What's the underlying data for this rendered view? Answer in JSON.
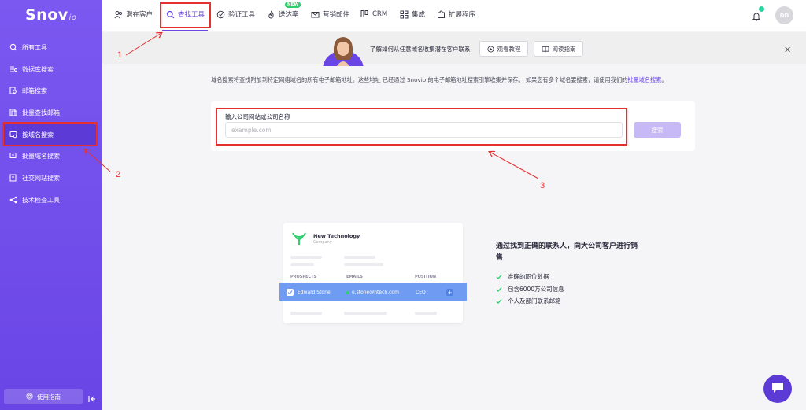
{
  "app": {
    "logo": "Snov",
    "logo_suffix": "io"
  },
  "sidebar": {
    "items": [
      {
        "label": "所有工具",
        "icon": "search-circle-icon"
      },
      {
        "label": "数据库搜索",
        "icon": "list-filter-icon"
      },
      {
        "label": "邮箱搜索",
        "icon": "doc-search-icon"
      },
      {
        "label": "批量查找邮箱",
        "icon": "bulk-doc-icon"
      },
      {
        "label": "按域名搜索",
        "icon": "domain-search-icon",
        "active": true
      },
      {
        "label": "批量域名搜索",
        "icon": "bulk-domain-icon"
      },
      {
        "label": "社交网站搜索",
        "icon": "social-search-icon"
      },
      {
        "label": "技术检查工具",
        "icon": "share-nodes-icon"
      }
    ],
    "guide_label": "使用指南"
  },
  "topnav": {
    "items": [
      {
        "label": "潜在客户",
        "icon": "users-icon"
      },
      {
        "label": "查找工具",
        "icon": "search-icon",
        "active": true
      },
      {
        "label": "验证工具",
        "icon": "check-circle-icon"
      },
      {
        "label": "送达率",
        "icon": "flame-icon",
        "badge": "NEW"
      },
      {
        "label": "营销邮件",
        "icon": "mail-icon"
      },
      {
        "label": "CRM",
        "icon": "crm-icon"
      },
      {
        "label": "集成",
        "icon": "grid-icon"
      },
      {
        "label": "扩展程序",
        "icon": "puzzle-icon"
      }
    ],
    "avatar_initials": "DD"
  },
  "banner": {
    "text": "了解如何从任意域名收集潜在客户联系",
    "watch_label": "观看教程",
    "read_label": "阅读指南"
  },
  "description": {
    "text": "域名搜索将查找附加到特定网络域名的所有电子邮箱地址。这些地址 已经通过 Snovio 的电子邮箱地址搜索引擎收集并保存。 如果您有多个域名要搜索，请使用我们的",
    "link": "批量域名搜索",
    "end": "。"
  },
  "search": {
    "label": "输入公司网站或公司名称",
    "placeholder": "example.com",
    "button": "搜索"
  },
  "annotations": {
    "a1": "1",
    "a2": "2",
    "a3": "3"
  },
  "preview": {
    "company": "New Technology",
    "company_sub": "Company",
    "headers": [
      "PROSPECTS",
      "EMAILS",
      "POSITION"
    ],
    "row": {
      "name": "Edward Stone",
      "email": "e.stone@ntech.com",
      "position": "CEO"
    }
  },
  "features": {
    "title": "通过找到正确的联系人，向大公司客户进行销售",
    "items": [
      "准确的职位数据",
      "包含6000万公司信息",
      "个人及部门联系邮箱"
    ]
  },
  "colors": {
    "accent": "#6a45e6",
    "sidebar": "#7b58f0",
    "annotation": "#e53030",
    "success": "#2ecf6a"
  }
}
